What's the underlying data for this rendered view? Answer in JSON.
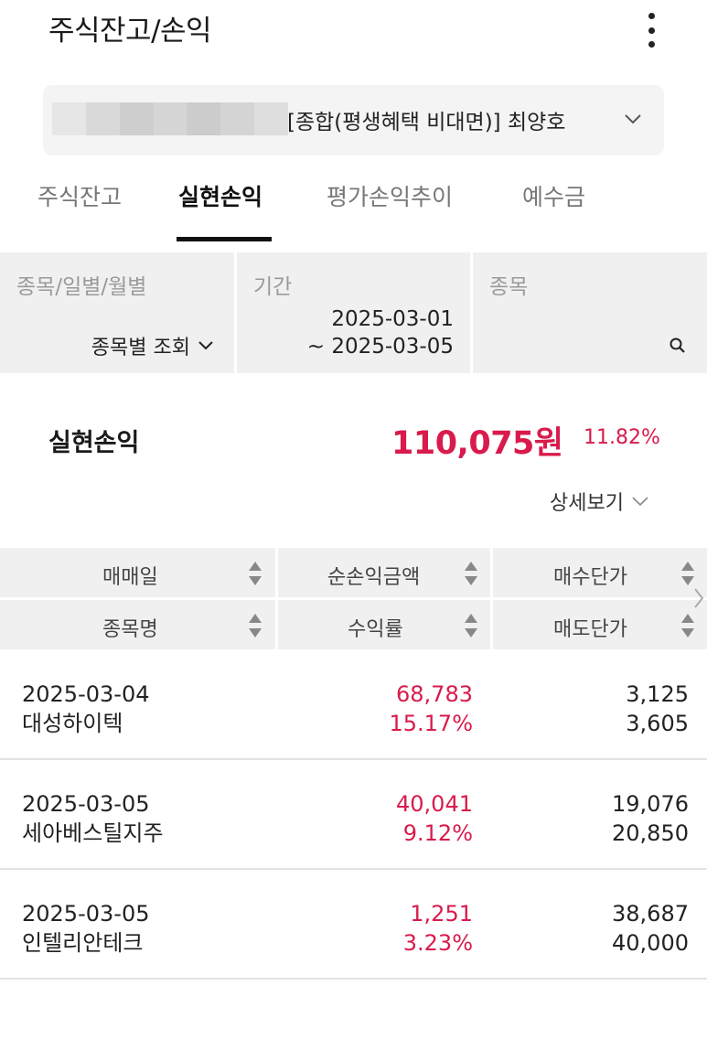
{
  "header": {
    "title": "주식잔고/손익",
    "more_icon": "more-vertical-icon"
  },
  "account": {
    "number_masked": "",
    "name": "[종합(평생혜택 비대면)]  최양호",
    "chevron_icon": "chevron-down-icon"
  },
  "tabs": [
    {
      "label": "주식잔고",
      "active": false
    },
    {
      "label": "실현손익",
      "active": true
    },
    {
      "label": "평가손익추이",
      "active": false
    },
    {
      "label": "예수금",
      "active": false
    }
  ],
  "filters": {
    "type": {
      "label": "종목/일별/월별",
      "value": "종목별 조회"
    },
    "period": {
      "label": "기간",
      "start": "2025-03-01",
      "end": "~ 2025-03-05"
    },
    "stock": {
      "label": "종목",
      "value": "",
      "icon": "search-icon"
    }
  },
  "summary": {
    "label": "실현손익",
    "amount": "110,075원",
    "rate": "11.82%",
    "detail_label": "상세보기"
  },
  "table": {
    "headers": {
      "row1": [
        "매매일",
        "순손익금액",
        "매수단가"
      ],
      "row2": [
        "종목명",
        "수익률",
        "매도단가"
      ]
    },
    "rows": [
      {
        "date": "2025-03-04",
        "name": "대성하이텍",
        "profit": "68,783",
        "rate": "15.17%",
        "buy_price": "3,125",
        "sell_price": "3,605"
      },
      {
        "date": "2025-03-05",
        "name": "세아베스틸지주",
        "profit": "40,041",
        "rate": "9.12%",
        "buy_price": "19,076",
        "sell_price": "20,850"
      },
      {
        "date": "2025-03-05",
        "name": "인텔리안테크",
        "profit": "1,251",
        "rate": "3.23%",
        "buy_price": "38,687",
        "sell_price": "40,000"
      }
    ]
  },
  "colors": {
    "accent_red": "#d81b4c",
    "panel_gray": "#f0f0f0"
  }
}
